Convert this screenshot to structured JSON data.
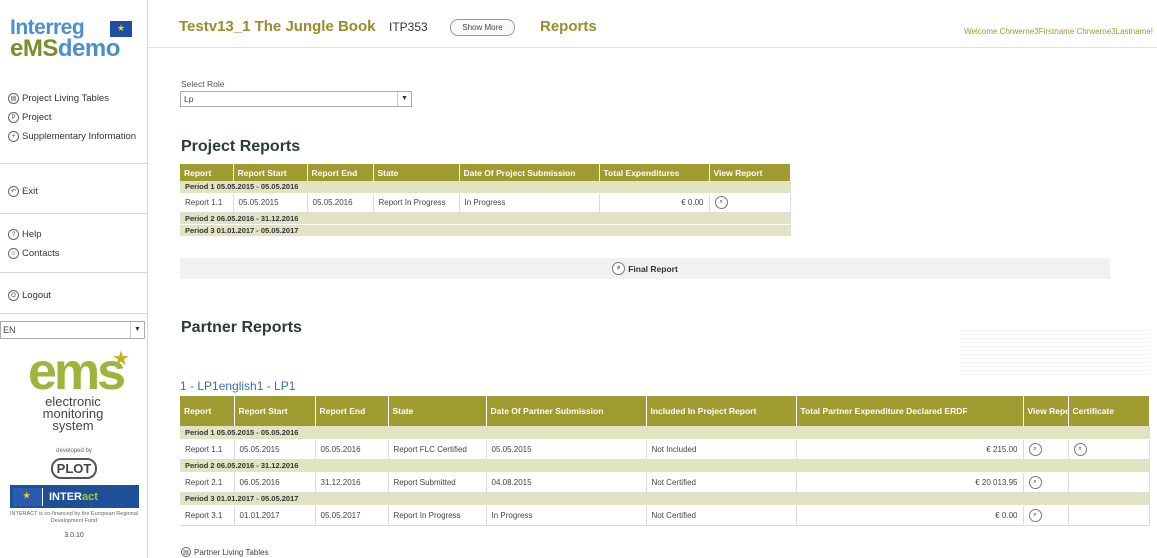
{
  "brand": {
    "line1": "Interreg",
    "line2a": "eMS",
    "line2b": "demo"
  },
  "sidebar": {
    "menu_top": [
      {
        "label": "Project Living Tables",
        "icon": "table-icon",
        "glyph": "▤"
      },
      {
        "label": "Project",
        "icon": "project-icon",
        "glyph": "P"
      },
      {
        "label": "Supplementary Information",
        "icon": "info-icon",
        "glyph": "+"
      }
    ],
    "exit": {
      "label": "Exit",
      "icon": "exit-icon",
      "glyph": "↶"
    },
    "menu_help": [
      {
        "label": "Help",
        "icon": "help-icon",
        "glyph": "?"
      },
      {
        "label": "Contacts",
        "icon": "contacts-icon",
        "glyph": "☺"
      }
    ],
    "logout": {
      "label": "Logout",
      "icon": "logout-icon",
      "glyph": "O"
    },
    "language": "EN",
    "ems_logo": {
      "text": "ems",
      "sub": "electronic monitoring system"
    },
    "developed_by": "developed by",
    "plot": "PLOT",
    "interact": {
      "a": "INTER",
      "b": "act"
    },
    "cofinanced": "INTERACT is co-financed by the European Regional Development Fund",
    "version": "3.0.10"
  },
  "header": {
    "project_title": "Testv13_1 The Jungle Book",
    "project_code": "ITP353",
    "show_more": "Show More",
    "page_title": "Reports",
    "welcome": "Welcome Chrwerne3Firstname Chrwerne3Lastname!"
  },
  "role": {
    "label": "Select Role",
    "value": "Lp"
  },
  "project_reports": {
    "title": "Project Reports",
    "columns": [
      "Report",
      "Report Start",
      "Report End",
      "State",
      "Date Of Project Submission",
      "Total Expenditures",
      "View Report"
    ],
    "periods": [
      {
        "label": "Period 1 05.05.2015 - 05.05.2016",
        "rows": [
          {
            "report": "Report 1.1",
            "start": "05.05.2015",
            "end": "05.05.2016",
            "state": "Report In Progress",
            "submission": "In Progress",
            "total": "€ 0.00"
          }
        ]
      },
      {
        "label": "Period 2 06.05.2016 - 31.12.2016",
        "rows": []
      },
      {
        "label": "Period 3 01.01.2017 - 05.05.2017",
        "rows": []
      }
    ],
    "final_report": "Final Report"
  },
  "partner_reports": {
    "title": "Partner Reports",
    "partner_link": "1 - LP1english1 - LP1",
    "columns": [
      "Report",
      "Report Start",
      "Report End",
      "State",
      "Date Of Partner Submission",
      "Included In Project Report",
      "Total Partner Expenditure Declared ERDF",
      "View Report",
      "Certificate"
    ],
    "periods": [
      {
        "label": "Period 1 05.05.2015 - 05.05.2016",
        "rows": [
          {
            "report": "Report 1.1",
            "start": "05.05.2015",
            "end": "05.05.2016",
            "state": "Report FLC Certified",
            "submission": "05.05.2015",
            "included": "Not Included",
            "total": "€ 215.00",
            "certificate": true
          }
        ]
      },
      {
        "label": "Period 2 06.05.2016 - 31.12.2016",
        "rows": [
          {
            "report": "Report 2.1",
            "start": "06.05.2016",
            "end": "31.12.2016",
            "state": "Report Submitted",
            "submission": "04.08.2015",
            "included": "Not Certified",
            "total": "€ 20 013.95",
            "certificate": false
          }
        ]
      },
      {
        "label": "Period 3 01.01.2017 - 05.05.2017",
        "rows": [
          {
            "report": "Report 3.1",
            "start": "01.01.2017",
            "end": "05.05.2017",
            "state": "Report In Progress",
            "submission": "In Progress",
            "included": "Not Certified",
            "total": "€ 0.00",
            "certificate": false
          }
        ]
      }
    ],
    "living_tables_link": "Partner Living Tables"
  },
  "colors": {
    "header_olive": "#a09b31",
    "period_bg": "#e2e3c2",
    "title_olive": "#9a8c2a",
    "link_blue": "#3a6fb0"
  }
}
